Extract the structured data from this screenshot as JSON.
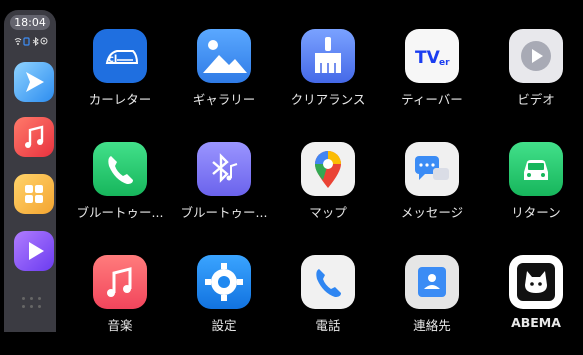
{
  "status_bar": {
    "time": "18:04",
    "icons": [
      "wifi-icon",
      "battery-icon",
      "bluetooth-icon",
      "location-icon"
    ]
  },
  "dock": {
    "apps": [
      {
        "name": "maps-app-icon",
        "color": "#4db8ff"
      },
      {
        "name": "music-app-icon",
        "color": "#f0454c"
      },
      {
        "name": "grid-app-icon",
        "color": "#f7b541"
      },
      {
        "name": "video-app-icon",
        "color": "#8a5cf6"
      }
    ],
    "menu_icon": "dots-grid-icon"
  },
  "apps": [
    {
      "label": "カーレター",
      "icon": "car-letter-icon",
      "color": "#1f6fe0"
    },
    {
      "label": "ギャラリー",
      "icon": "gallery-icon",
      "color": "#3a8df7"
    },
    {
      "label": "クリアランス",
      "icon": "broom-icon",
      "color": "#5b84ef"
    },
    {
      "label": "ティーバー",
      "icon": "tver-icon",
      "color": "#f7f7f7"
    },
    {
      "label": "ビデオ",
      "icon": "video-play-icon",
      "color": "#e8e8ec"
    },
    {
      "label": "ブルートゥー...",
      "icon": "phone-icon",
      "color": "#22c96d"
    },
    {
      "label": "ブルートゥー...",
      "icon": "bluetooth-music-icon",
      "color": "#7e79f2"
    },
    {
      "label": "マップ",
      "icon": "google-maps-icon",
      "color": "#f1f1f1"
    },
    {
      "label": "メッセージ",
      "icon": "message-icon",
      "color": "#f0f0f0"
    },
    {
      "label": "リターン",
      "icon": "car-return-icon",
      "color": "#22c96d"
    },
    {
      "label": "音楽",
      "icon": "music-note-icon",
      "color": "#fc5b5b"
    },
    {
      "label": "設定",
      "icon": "settings-gear-icon",
      "color": "#1e88f0"
    },
    {
      "label": "電話",
      "icon": "phone-handset-icon",
      "color": "#f1f1f1"
    },
    {
      "label": "連絡先",
      "icon": "contacts-icon",
      "color": "#e6e6e6"
    },
    {
      "label": "ABEMA",
      "icon": "abema-icon",
      "color": "#ffffff"
    }
  ]
}
